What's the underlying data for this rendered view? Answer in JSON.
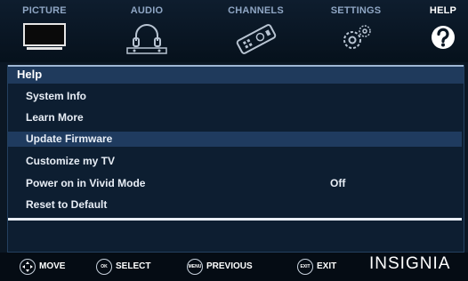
{
  "tabs": [
    {
      "label": "PICTURE",
      "icon": "tv-icon"
    },
    {
      "label": "AUDIO",
      "icon": "headphones-icon"
    },
    {
      "label": "CHANNELS",
      "icon": "remote-icon"
    },
    {
      "label": "SETTINGS",
      "icon": "gears-icon"
    },
    {
      "label": "HELP",
      "icon": "question-icon",
      "active": true
    }
  ],
  "panel": {
    "title": "Help",
    "items": [
      {
        "label": "System Info",
        "value": ""
      },
      {
        "label": "Learn More",
        "value": ""
      },
      {
        "label": "Update Firmware",
        "value": "",
        "selected": true
      },
      {
        "label": "Customize my TV",
        "value": ""
      },
      {
        "label": "Power on in Vivid Mode",
        "value": "Off"
      },
      {
        "label": "Reset to Default",
        "value": ""
      }
    ]
  },
  "hints": [
    {
      "button": "",
      "label": "MOVE"
    },
    {
      "button": "OK",
      "label": "SELECT"
    },
    {
      "button": "MENU",
      "label": "PREVIOUS"
    },
    {
      "button": "EXIT",
      "label": "EXIT"
    }
  ],
  "brand": "INSIGNIA",
  "colors": {
    "background": "#0b1724",
    "title_bar": "#1f3a5c",
    "selected_row": "#1f3b5f",
    "inactive_tab_text": "#8fa6c4"
  }
}
